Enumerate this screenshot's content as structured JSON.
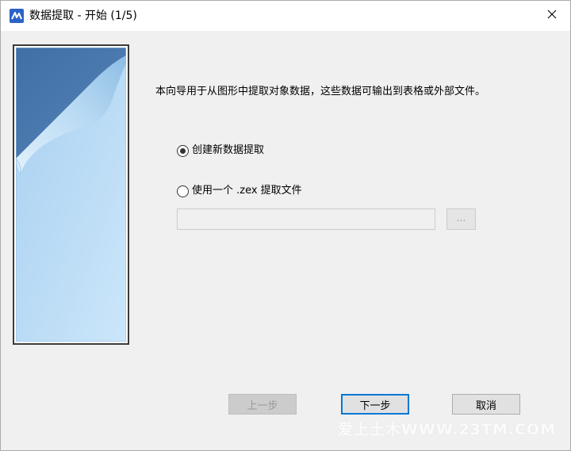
{
  "window": {
    "title": "数据提取 - 开始 (1/5)",
    "app_icon": "autocad-logo-icon",
    "close_glyph": "✕"
  },
  "intro_text": "本向导用于从图形中提取对象数据，这些数据可输出到表格或外部文件。",
  "options": {
    "create_new": {
      "label": "创建新数据提取",
      "checked": true
    },
    "use_existing": {
      "label": "使用一个 .zex 提取文件",
      "checked": false
    }
  },
  "file_path": {
    "value": "",
    "enabled": false
  },
  "browse_button": {
    "label": "..."
  },
  "buttons": {
    "back": {
      "label": "上一步",
      "enabled": false
    },
    "next": {
      "label": "下一步",
      "enabled": true,
      "default": true
    },
    "cancel": {
      "label": "取消",
      "enabled": true
    }
  },
  "watermark": "爱上土木WWW.23TM.COM",
  "colors": {
    "banner_dark": "#4a78ad",
    "banner_light": "#c6e2f7",
    "accent": "#0078d7"
  }
}
